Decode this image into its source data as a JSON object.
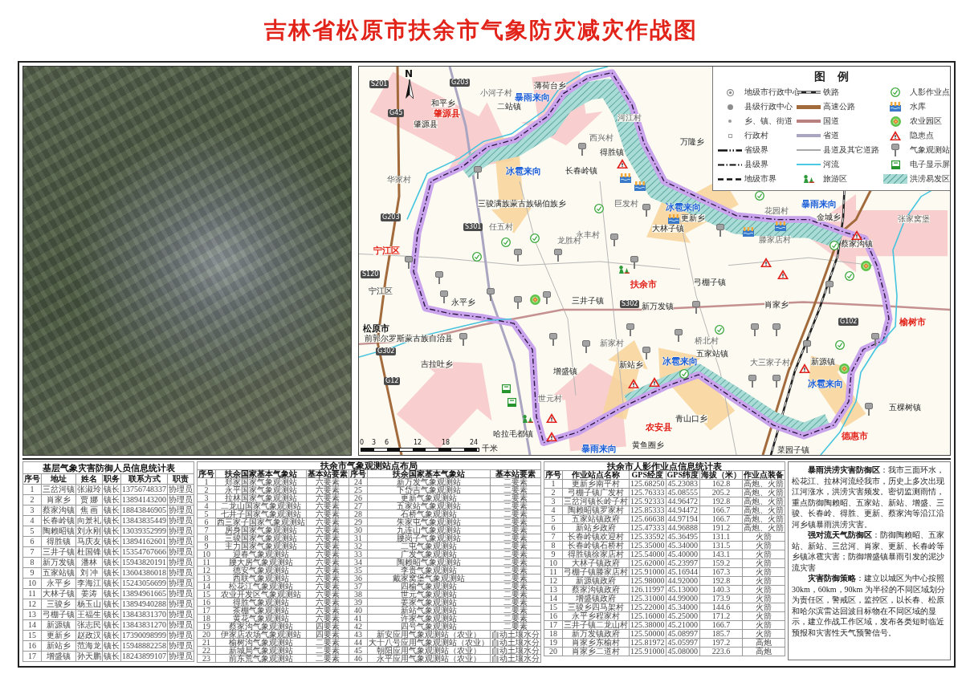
{
  "title": "吉林省松原市扶余市气象防灾减灾作战图",
  "map": {
    "compass_label": "N",
    "labels": [
      {
        "text": "S201",
        "kind": "road"
      },
      {
        "text": "G203",
        "kind": "road"
      },
      {
        "text": "薄荷台乡",
        "kind": "town"
      },
      {
        "text": "小河子村",
        "kind": "village"
      },
      {
        "text": "暴雨来向",
        "kind": "direction"
      },
      {
        "text": "和平乡",
        "kind": "town"
      },
      {
        "text": "二站镇",
        "kind": "town"
      },
      {
        "text": "G45",
        "kind": "road"
      },
      {
        "text": "肇源县",
        "kind": "county"
      },
      {
        "text": "河江村",
        "kind": "village"
      },
      {
        "text": "肇源县",
        "kind": "town"
      },
      {
        "text": "西兴村",
        "kind": "village"
      },
      {
        "text": "万隆乡",
        "kind": "town"
      },
      {
        "text": "得胜镇",
        "kind": "town"
      },
      {
        "text": "冰雹来向",
        "kind": "direction"
      },
      {
        "text": "长春岭镇",
        "kind": "town"
      },
      {
        "text": "华家村",
        "kind": "village"
      },
      {
        "text": "三骏满族蒙古族锡伯族乡",
        "kind": "town"
      },
      {
        "text": "巨发村",
        "kind": "village"
      },
      {
        "text": "冰雹来向",
        "kind": "direction"
      },
      {
        "text": "暴雨来向",
        "kind": "direction"
      },
      {
        "text": "花园村",
        "kind": "village"
      },
      {
        "text": "G203",
        "kind": "road"
      },
      {
        "text": "更新乡",
        "kind": "town"
      },
      {
        "text": "金城乡",
        "kind": "town"
      },
      {
        "text": "张家窝堡",
        "kind": "village"
      },
      {
        "text": "S301",
        "kind": "road"
      },
      {
        "text": "任五村",
        "kind": "village"
      },
      {
        "text": "大林子镇",
        "kind": "town"
      },
      {
        "text": "永丰村",
        "kind": "village"
      },
      {
        "text": "龙胜村",
        "kind": "village"
      },
      {
        "text": "滕家店村",
        "kind": "village"
      },
      {
        "text": "蔡家沟镇",
        "kind": "town"
      },
      {
        "text": "宁江区",
        "kind": "county"
      },
      {
        "text": "S120",
        "kind": "road"
      },
      {
        "text": "扶余市",
        "kind": "county"
      },
      {
        "text": "弓棚子镇",
        "kind": "town"
      },
      {
        "text": "宁江区",
        "kind": "town"
      },
      {
        "text": "永平乡",
        "kind": "town"
      },
      {
        "text": "三井子镇",
        "kind": "town"
      },
      {
        "text": "S302",
        "kind": "road"
      },
      {
        "text": "新万发镇",
        "kind": "town"
      },
      {
        "text": "肖家乡",
        "kind": "town"
      },
      {
        "text": "G102",
        "kind": "road"
      },
      {
        "text": "榆树市",
        "kind": "county"
      },
      {
        "text": "松原市",
        "kind": "seat"
      },
      {
        "text": "前郭尔罗斯蒙古族自治县",
        "kind": "town"
      },
      {
        "text": "新家村",
        "kind": "village"
      },
      {
        "text": "桥北村",
        "kind": "village"
      },
      {
        "text": "G302",
        "kind": "road"
      },
      {
        "text": "五家站镇",
        "kind": "town"
      },
      {
        "text": "吉拉吐乡",
        "kind": "town"
      },
      {
        "text": "新站乡",
        "kind": "town"
      },
      {
        "text": "冰雹来向",
        "kind": "direction"
      },
      {
        "text": "大三家子村",
        "kind": "village"
      },
      {
        "text": "新源镇",
        "kind": "town"
      },
      {
        "text": "增盛镇",
        "kind": "town"
      },
      {
        "text": "G12",
        "kind": "road"
      },
      {
        "text": "冰雹来向",
        "kind": "direction"
      },
      {
        "text": "世元村",
        "kind": "village"
      },
      {
        "text": "五棵树镇",
        "kind": "town"
      },
      {
        "text": "青山口乡",
        "kind": "town"
      },
      {
        "text": "农安县",
        "kind": "county"
      },
      {
        "text": "哈拉毛都镇",
        "kind": "town"
      },
      {
        "text": "德惠市",
        "kind": "county"
      },
      {
        "text": "暴雨来向",
        "kind": "direction"
      },
      {
        "text": "黄鱼圈乡",
        "kind": "town"
      },
      {
        "text": "菜园子镇",
        "kind": "town"
      }
    ],
    "scale_bar": {
      "ticks": [
        "0",
        "3",
        "6",
        "12",
        "18",
        "24"
      ],
      "unit": "千米"
    },
    "legend": {
      "title": "图 例",
      "items": [
        {
          "kind": "prefecture-center",
          "label": "地级市行政中心"
        },
        {
          "kind": "railway",
          "label": "铁路"
        },
        {
          "kind": "operation-point",
          "label": "人影作业点"
        },
        {
          "kind": "county-center",
          "label": "县级行政中心"
        },
        {
          "kind": "expressway",
          "label": "高速公路"
        },
        {
          "kind": "reservoir",
          "label": "水库"
        },
        {
          "kind": "township",
          "label": "乡、镇、街道"
        },
        {
          "kind": "national-road",
          "label": "国道"
        },
        {
          "kind": "farm-park",
          "label": "农业园区"
        },
        {
          "kind": "village",
          "label": "行政村"
        },
        {
          "kind": "provincial-road",
          "label": "省道"
        },
        {
          "kind": "hazard",
          "label": "隐患点"
        },
        {
          "kind": "province-border",
          "label": "省级界"
        },
        {
          "kind": "other-road",
          "label": "县道及其它道路"
        },
        {
          "kind": "station",
          "label": "气象观测站"
        },
        {
          "kind": "county-border",
          "label": "县级界"
        },
        {
          "kind": "river",
          "label": "河流"
        },
        {
          "kind": "screen",
          "label": "电子显示屏"
        },
        {
          "kind": "city-border",
          "label": "地级市界"
        },
        {
          "kind": "tourism",
          "label": "旅游区"
        },
        {
          "kind": "flood-zone",
          "label": "洪涝易发区"
        }
      ]
    }
  },
  "personnel_table": {
    "title": "基层气象灾害防御人员信息统计表",
    "columns": [
      "序号",
      "地址",
      "姓名",
      "职务",
      "联系方式",
      "职责"
    ],
    "rows": [
      [
        "1",
        "三岔河镇",
        "张淑玲",
        "镇长",
        "13756748337",
        "协理员"
      ],
      [
        "2",
        "肖家乡",
        "贾 娜",
        "镇长",
        "13894143200",
        "协理员"
      ],
      [
        "3",
        "蔡家沟镇",
        "焦 画",
        "镇长",
        "18843846905",
        "协理员"
      ],
      [
        "4",
        "长春岭镇",
        "向景礼",
        "镇长",
        "13843835449",
        "协理员"
      ],
      [
        "5",
        "陶赖昭镇",
        "刘永刚",
        "镇长",
        "13039352999",
        "协理员"
      ],
      [
        "6",
        "得胜镇",
        "马庆友",
        "镇长",
        "13894162601",
        "协理员"
      ],
      [
        "7",
        "三井子镇",
        "杜国锋",
        "镇长",
        "15354767666",
        "协理员"
      ],
      [
        "8",
        "新万发镇",
        "潘林",
        "镇长",
        "15943820191",
        "协理员"
      ],
      [
        "9",
        "五家站镇",
        "刘 冲",
        "镇长",
        "13604386018",
        "协理员"
      ],
      [
        "10",
        "永平乡",
        "李海江",
        "镇长",
        "15243056699",
        "协理员"
      ],
      [
        "11",
        "大林子镇",
        "姜涛",
        "镇长",
        "13894961665",
        "协理员"
      ],
      [
        "12",
        "三骏乡",
        "杨玉山",
        "镇长",
        "13894940288",
        "协理员"
      ],
      [
        "13",
        "弓棚子镇",
        "王福生",
        "镇长",
        "13843831370",
        "协理员"
      ],
      [
        "14",
        "新源镇",
        "张志民",
        "镇长",
        "13843831270",
        "协理员"
      ],
      [
        "15",
        "更新乡",
        "赵政汉",
        "镇长",
        "17390098999",
        "协理员"
      ],
      [
        "16",
        "新站乡",
        "范海龙",
        "镇长",
        "15948882258",
        "协理员"
      ],
      [
        "17",
        "增盛镇",
        "孙天鹏",
        "镇长",
        "18243899107",
        "协理员"
      ]
    ]
  },
  "station_table": {
    "title": "扶余市气象观测站点布局",
    "columns": [
      "序号",
      "扶余国家基本气象站",
      "基本站要素",
      "序号",
      "扶余国家基本气象站",
      "基本站要素"
    ],
    "rows": [
      [
        "1",
        "郑家国家气象观测站",
        "六要素",
        "24",
        "新万发气象观测站",
        "二要素"
      ],
      [
        "2",
        "永平国家气象观测站",
        "六要素",
        "25",
        "下岱吉气象观测站",
        "二要素"
      ],
      [
        "3",
        "拉林国家气象观测站",
        "六要素",
        "26",
        "更新气象观测站",
        "二要素"
      ],
      [
        "4",
        "二龙山国家气象观测站",
        "六要素",
        "27",
        "五家站气象观测站",
        "二要素"
      ],
      [
        "5",
        "七井子国家气象观测站",
        "六要素",
        "28",
        "石桥气象观测站",
        "二要素"
      ],
      [
        "6",
        "西三家子国家气象观测站",
        "六要素",
        "29",
        "朱家屯气象观测站",
        "二要素"
      ],
      [
        "7",
        "房身国家气象观测站",
        "六要素",
        "30",
        "九连山气象观测站",
        "二要素"
      ],
      [
        "8",
        "三骏国家气象观测站",
        "六要素",
        "31",
        "腰岗子气象观测站",
        "二要素"
      ],
      [
        "9",
        "主力国家气象观测站",
        "六要素",
        "32",
        "二屯气象观测站",
        "二要素"
      ],
      [
        "10",
        "迎春气象观测站",
        "六要素",
        "33",
        "广发气象观测站",
        "二要素"
      ],
      [
        "11",
        "腰大房气象观测站",
        "六要素",
        "34",
        "陶赖昭气象观测站",
        "二要素"
      ],
      [
        "12",
        "德安气象观测站",
        "六要素",
        "35",
        "李贵气象观测站",
        "二要素"
      ],
      [
        "13",
        "西联气象观测站",
        "六要素",
        "36",
        "戴家窝堡气象观测站",
        "二要素"
      ],
      [
        "14",
        "松花江气象观测站",
        "六要素",
        "37",
        "四榆气象观测站",
        "二要素"
      ],
      [
        "15",
        "农业开发区气象观测站",
        "六要素",
        "38",
        "世元气象观测站",
        "二要素"
      ],
      [
        "16",
        "得胜气象观测站",
        "六要素",
        "39",
        "姜家气象观测站",
        "二要素"
      ],
      [
        "17",
        "茶棚气象观测站",
        "六要素",
        "40",
        "新站气象观测站",
        "二要素"
      ],
      [
        "18",
        "黄花气象观测站",
        "六要素",
        "41",
        "许家气象观测站",
        "二要素"
      ],
      [
        "19",
        "蔡家沟气象观测站",
        "四要素",
        "42",
        "四号气象观测站",
        "二要素"
      ],
      [
        "20",
        "伊家店农场气象观测站",
        "四要素",
        "43",
        "新安应用气象观测站（农业）",
        "自动土壤水分"
      ],
      [
        "21",
        "榆树沟气象观测站",
        "二要素",
        "44",
        "大十八号应用气象观测站（农业）",
        "自动土壤水分"
      ],
      [
        "22",
        "新城局气象观测站",
        "二要素",
        "45",
        "朝阳应用气象观测站（农业）",
        "自动土壤水分"
      ],
      [
        "23",
        "前东荒气象观测站",
        "二要素",
        "46",
        "永平应用气象观测站（农业）",
        "自动土壤水分"
      ]
    ]
  },
  "operation_point_table": {
    "title": "扶余市人影作业点信息统计表",
    "columns": [
      "序号",
      "作业站点名称",
      "GPS经度",
      "GPS纬度",
      "海拔（米）",
      "作业点装备"
    ],
    "rows": [
      [
        "1",
        "更新乡南平村",
        "125.68250",
        "45.23083",
        "162.8",
        "高炮、火箭"
      ],
      [
        "2",
        "弓棚子镇广发村",
        "125.76333",
        "45.08555",
        "205.2",
        "高炮、火箭"
      ],
      [
        "3",
        "三岔河镇长岭子村",
        "125.92333",
        "44.96472",
        "192.8",
        "高炮、火箭"
      ],
      [
        "4",
        "陶赖昭镇罗家村",
        "125.85333",
        "44.94472",
        "166.7",
        "高炮、火箭"
      ],
      [
        "5",
        "五家站镇政府",
        "125.66638",
        "44.97194",
        "166.7",
        "高炮、火箭"
      ],
      [
        "6",
        "新站乡政府",
        "125.47333",
        "44.96888",
        "191.2",
        "高炮、火箭"
      ],
      [
        "7",
        "长春岭镇欢迎村",
        "125.33592",
        "45.36495",
        "131.1",
        "火箭"
      ],
      [
        "8",
        "长春岭镇石桥村",
        "125.35000",
        "45.34000",
        "131.5",
        "火箭"
      ],
      [
        "9",
        "得胜镇徐家店村",
        "125.54000",
        "45.40000",
        "143.1",
        "火箭"
      ],
      [
        "10",
        "大林子镇政府",
        "125.62000",
        "45.23997",
        "159.2",
        "火箭"
      ],
      [
        "11",
        "弓棚子镇滕家店村",
        "125.91000",
        "45.16944",
        "167.3",
        "火箭"
      ],
      [
        "12",
        "新源镇政府",
        "125.98000",
        "44.92000",
        "192.8",
        "火箭"
      ],
      [
        "13",
        "蔡家沟镇政府",
        "126.11997",
        "45.13000",
        "140.3",
        "火箭"
      ],
      [
        "14",
        "增盛镇政府",
        "125.31000",
        "44.99000",
        "173.9",
        "火箭"
      ],
      [
        "15",
        "三骏乡四马架村",
        "125.22000",
        "45.34000",
        "144.6",
        "火箭"
      ],
      [
        "16",
        "永平乡程家村",
        "125.16000",
        "45.25000",
        "171.2",
        "火箭"
      ],
      [
        "17",
        "三井子镇二龙山村",
        "125.38000",
        "45.21000",
        "166.7",
        "火箭"
      ],
      [
        "18",
        "新万发镇政府",
        "125.50000",
        "45.08997",
        "185.7",
        "火箭"
      ],
      [
        "19",
        "肖家乡东榆村",
        "125.81972",
        "45.05997",
        "197.2",
        "高炮"
      ],
      [
        "20",
        "肖家乡二道村",
        "125.91000",
        "45.08000",
        "223.6",
        "高炮"
      ]
    ]
  },
  "defense_notes": [
    "**暴雨洪涝灾害防御区**：我市三面环水，松花江、拉林河流经我市，历史上多次出现江河涨水，洪涝灾害频发。密切监测雨情，重点防御陶赖昭、五家站、新站、增盛、三骏、长春岭、得胜、更新、蔡家沟等沿江沿河乡镇暴雨洪涝灾害。",
    "**强对流天气防御区**：防御陶赖昭、五家站、新站、三岔河、肖家、更新、长春岭等乡镇冰雹灾害；防御增盛镇暴雨引发的泥沙流灾害",
    "**灾害防御策略**：建立以城区为中心按照30km，60km，90km 为半径的不同区域划分为责任区，警戒区，监控区，以长春、松原和哈尔滨雷达回波目标物在不同区域的显示，建立作战工作区域，发布各类短时临近预报和灾害性天气预警信号。"
  ]
}
